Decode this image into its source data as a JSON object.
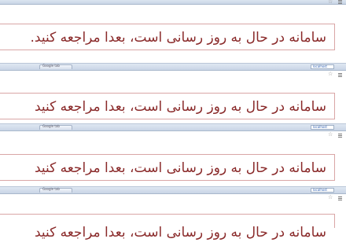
{
  "message": "سامانه در حال به روز رسانی است، بعدا مراجعه کنید.",
  "message_nodot": "سامانه در حال به روز رسانی است، بعدا مراجعه کنید",
  "tab_label": "Google tab",
  "address_text": "localhost",
  "icons": {
    "star": "star-icon",
    "menu": "menu-icon"
  },
  "colors": {
    "message_text": "#8a2a2a",
    "message_border": "#d9a6a6",
    "chrome": "#c9d5e6"
  }
}
